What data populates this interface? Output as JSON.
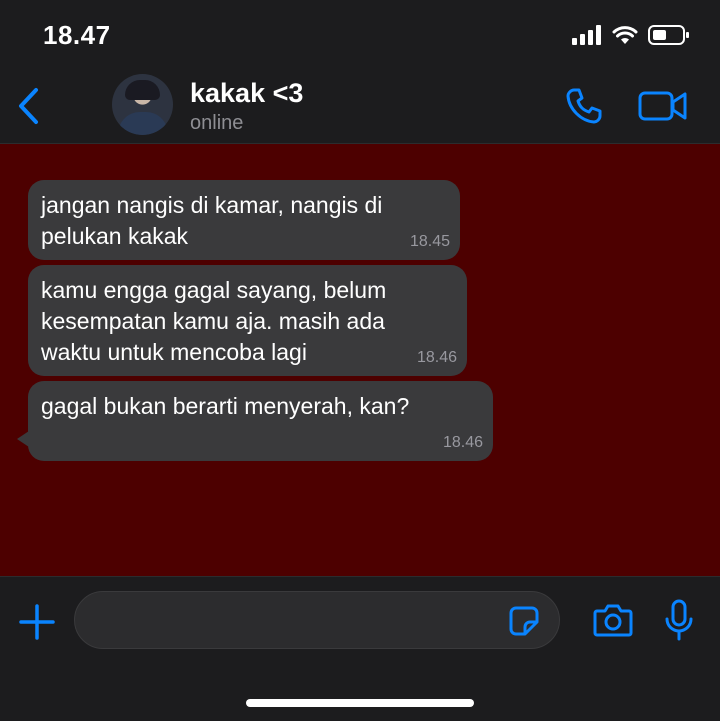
{
  "status_bar": {
    "time": "18.47"
  },
  "header": {
    "contact_name": "kakak <3",
    "contact_status": "online"
  },
  "messages": [
    {
      "text": "jangan nangis di kamar, nangis di\npelukan kakak",
      "time": "18.45"
    },
    {
      "text": "kamu engga gagal sayang, belum\nkesempatan kamu aja. masih ada\nwaktu untuk mencoba lagi",
      "time": "18.46"
    },
    {
      "text": "gagal bukan berarti menyerah, kan?",
      "time": "18.46"
    }
  ],
  "input": {
    "placeholder": "",
    "value": ""
  },
  "icons": {
    "back": "chevron-left-icon",
    "call": "phone-icon",
    "video": "video-camera-icon",
    "plus": "plus-icon",
    "sticker": "sticker-icon",
    "camera": "camera-icon",
    "mic": "microphone-icon"
  },
  "colors": {
    "accent": "#0a84ff",
    "chat_background": "#4d0000",
    "bubble_incoming": "#3a3a3c",
    "bar_background": "#1c1c1e"
  }
}
